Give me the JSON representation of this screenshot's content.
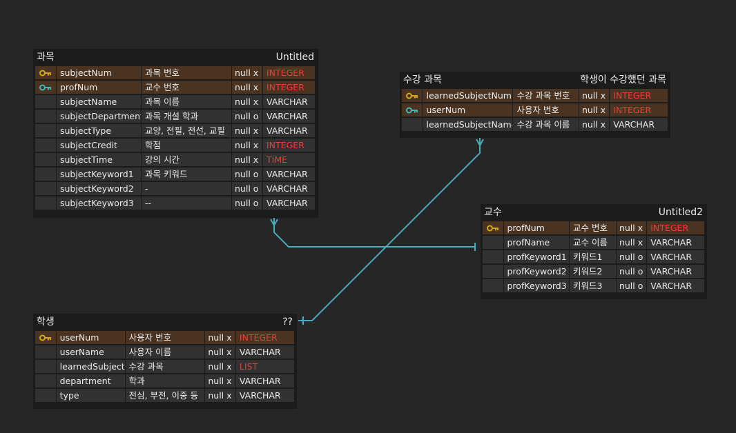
{
  "colors": {
    "background": "#262626",
    "table_bg": "#1b1b1b",
    "cell_bg": "#313131",
    "key_row_bg": "#4a3320",
    "primary_key_icon": "#d4a61c",
    "foreign_key_icon": "#3fb8b8",
    "special_type": "#ee3c3c",
    "connector": "#4aaab8"
  },
  "tables": [
    {
      "id": "subject",
      "title": "과목",
      "comment": "Untitled",
      "cols": [
        30,
        122,
        130,
        44,
        75
      ],
      "rows": [
        {
          "key": "primary",
          "name": "subjectNum",
          "desc": "과목 번호",
          "nullable": "null x",
          "type": "INTEGER",
          "special": true
        },
        {
          "key": "foreign",
          "name": "profNum",
          "desc": "교수 번호",
          "nullable": "null x",
          "type": "INTEGER",
          "special": true
        },
        {
          "key": "",
          "name": "subjectName",
          "desc": "과목 이름",
          "nullable": "null x",
          "type": "VARCHAR",
          "special": false
        },
        {
          "key": "",
          "name": "subjectDepartment",
          "desc": "과목 개설 학과",
          "nullable": "null o",
          "type": "VARCHAR",
          "special": false
        },
        {
          "key": "",
          "name": "subjectType",
          "desc": "교양, 전필, 전선, 교필",
          "nullable": "null x",
          "type": "VARCHAR",
          "special": false
        },
        {
          "key": "",
          "name": "subjectCredit",
          "desc": "학점",
          "nullable": "null x",
          "type": "INTEGER",
          "special": true
        },
        {
          "key": "",
          "name": "subjectTime",
          "desc": "강의 시간",
          "nullable": "null x",
          "type": "TIME",
          "special": true
        },
        {
          "key": "",
          "name": "subjectKeyword1",
          "desc": "과목 키워드",
          "nullable": "null o",
          "type": "VARCHAR",
          "special": false
        },
        {
          "key": "",
          "name": "subjectKeyword2",
          "desc": "-",
          "nullable": "null o",
          "type": "VARCHAR",
          "special": false
        },
        {
          "key": "",
          "name": "subjectKeyword3",
          "desc": "--",
          "nullable": "null o",
          "type": "VARCHAR",
          "special": false
        }
      ]
    },
    {
      "id": "learned",
      "title": "수강 과목",
      "comment": "학생이 수강했던 과목",
      "cols": [
        30,
        132,
        96,
        44,
        85
      ],
      "rows": [
        {
          "key": "primary",
          "name": "learnedSubjectNum",
          "desc": "수강 과목 번호",
          "nullable": "null x",
          "type": "INTEGER",
          "special": true
        },
        {
          "key": "foreign",
          "name": "userNum",
          "desc": "사용자 번호",
          "nullable": "null x",
          "type": "INTEGER",
          "special": true
        },
        {
          "key": "",
          "name": "learnedSubjectName",
          "desc": "수강 과목 이름",
          "nullable": "null x",
          "type": "VARCHAR",
          "special": false
        }
      ]
    },
    {
      "id": "prof",
      "title": "교수",
      "comment": "Untitled2",
      "cols": [
        30,
        96,
        68,
        44,
        84
      ],
      "rows": [
        {
          "key": "primary",
          "name": "profNum",
          "desc": "교수 번호",
          "nullable": "null x",
          "type": "INTEGER",
          "special": true
        },
        {
          "key": "",
          "name": "profName",
          "desc": "교수 이름",
          "nullable": "null x",
          "type": "VARCHAR",
          "special": false
        },
        {
          "key": "",
          "name": "profKeyword1",
          "desc": "키워드1",
          "nullable": "null o",
          "type": "VARCHAR",
          "special": false
        },
        {
          "key": "",
          "name": "profKeyword2",
          "desc": "키워드2",
          "nullable": "null o",
          "type": "VARCHAR",
          "special": false
        },
        {
          "key": "",
          "name": "profKeyword3",
          "desc": "키워드3",
          "nullable": "null o",
          "type": "VARCHAR",
          "special": false
        }
      ]
    },
    {
      "id": "student",
      "title": "학생",
      "comment": "??",
      "cols": [
        30,
        100,
        116,
        44,
        85
      ],
      "rows": [
        {
          "key": "primary",
          "name": "userNum",
          "desc": "사용자 번호",
          "nullable": "null x",
          "type": "INTEGER",
          "special": true
        },
        {
          "key": "",
          "name": "userName",
          "desc": "사용자 이름",
          "nullable": "null x",
          "type": "VARCHAR",
          "special": false
        },
        {
          "key": "",
          "name": "learnedSubject",
          "desc": "수강 과목",
          "nullable": "null x",
          "type": "LIST",
          "special": true
        },
        {
          "key": "",
          "name": "department",
          "desc": "학과",
          "nullable": "null x",
          "type": "VARCHAR",
          "special": false
        },
        {
          "key": "",
          "name": "type",
          "desc": "전심, 부전, 이중 등",
          "nullable": "null x",
          "type": "VARCHAR",
          "special": false
        }
      ]
    }
  ]
}
